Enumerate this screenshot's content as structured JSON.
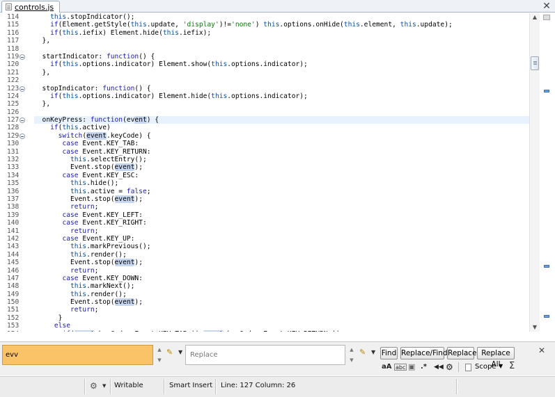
{
  "tab": {
    "title": "controls.js",
    "close": "✕"
  },
  "editor": {
    "current_line": 127,
    "lines": [
      {
        "n": "114",
        "fold": false,
        "html": "    <span class=\"th\">this</span>.stopIndicator();"
      },
      {
        "n": "115",
        "fold": false,
        "html": "    <span class=\"kw\">if</span>(Element.getStyle(<span class=\"th\">this</span>.update, <span class=\"st\">'display'</span>)!=<span class=\"st\">'none'</span>) <span class=\"th\">this</span>.options.onHide(<span class=\"th\">this</span>.element, <span class=\"th\">this</span>.update);"
      },
      {
        "n": "116",
        "fold": false,
        "html": "    <span class=\"kw\">if</span>(<span class=\"th\">this</span>.iefix) Element.hide(<span class=\"th\">this</span>.iefix);"
      },
      {
        "n": "117",
        "fold": false,
        "html": "  },"
      },
      {
        "n": "118",
        "fold": false,
        "html": ""
      },
      {
        "n": "119",
        "fold": true,
        "html": "  startIndicator: <span class=\"kw\">function</span>() {"
      },
      {
        "n": "120",
        "fold": false,
        "html": "    <span class=\"kw\">if</span>(<span class=\"th\">this</span>.options.indicator) Element.show(<span class=\"th\">this</span>.options.indicator);"
      },
      {
        "n": "121",
        "fold": false,
        "html": "  },"
      },
      {
        "n": "122",
        "fold": false,
        "html": ""
      },
      {
        "n": "123",
        "fold": true,
        "html": "  stopIndicator: <span class=\"kw\">function</span>() {"
      },
      {
        "n": "124",
        "fold": false,
        "html": "    <span class=\"kw\">if</span>(<span class=\"th\">this</span>.options.indicator) Element.hide(<span class=\"th\">this</span>.options.indicator);"
      },
      {
        "n": "125",
        "fold": false,
        "html": "  },"
      },
      {
        "n": "126",
        "fold": false,
        "html": ""
      },
      {
        "n": "127",
        "fold": true,
        "html": "  onKeyPress: <span class=\"kw\">function</span>(ev<span class=\"hl\">ent</span>) {"
      },
      {
        "n": "128",
        "fold": false,
        "html": "    <span class=\"kw\">if</span>(<span class=\"th\">this</span>.active)"
      },
      {
        "n": "129",
        "fold": true,
        "html": "      <span class=\"kw\">switch</span>(<span class=\"hl\">event</span>.keyCode) {"
      },
      {
        "n": "130",
        "fold": false,
        "html": "       <span class=\"kw\">case</span> Event.KEY_TAB:"
      },
      {
        "n": "131",
        "fold": false,
        "html": "       <span class=\"kw\">case</span> Event.KEY_RETURN:"
      },
      {
        "n": "132",
        "fold": false,
        "html": "         <span class=\"th\">this</span>.selectEntry();"
      },
      {
        "n": "133",
        "fold": false,
        "html": "         Event.stop(<span class=\"hl\">event</span>);"
      },
      {
        "n": "134",
        "fold": false,
        "html": "       <span class=\"kw\">case</span> Event.KEY_ESC:"
      },
      {
        "n": "135",
        "fold": false,
        "html": "         <span class=\"th\">this</span>.hide();"
      },
      {
        "n": "136",
        "fold": false,
        "html": "         <span class=\"th\">this</span>.active = <span class=\"kw\">false</span>;"
      },
      {
        "n": "137",
        "fold": false,
        "html": "         Event.stop(<span class=\"hl\">event</span>);"
      },
      {
        "n": "138",
        "fold": false,
        "html": "         <span class=\"kw\">return</span>;"
      },
      {
        "n": "139",
        "fold": false,
        "html": "       <span class=\"kw\">case</span> Event.KEY_LEFT:"
      },
      {
        "n": "140",
        "fold": false,
        "html": "       <span class=\"kw\">case</span> Event.KEY_RIGHT:"
      },
      {
        "n": "141",
        "fold": false,
        "html": "         <span class=\"kw\">return</span>;"
      },
      {
        "n": "142",
        "fold": false,
        "html": "       <span class=\"kw\">case</span> Event.KEY_UP:"
      },
      {
        "n": "143",
        "fold": false,
        "html": "         <span class=\"th\">this</span>.markPrevious();"
      },
      {
        "n": "144",
        "fold": false,
        "html": "         <span class=\"th\">this</span>.render();"
      },
      {
        "n": "145",
        "fold": false,
        "html": "         Event.stop(<span class=\"hl\">event</span>);"
      },
      {
        "n": "146",
        "fold": false,
        "html": "         <span class=\"kw\">return</span>;"
      },
      {
        "n": "147",
        "fold": false,
        "html": "       <span class=\"kw\">case</span> Event.KEY_DOWN:"
      },
      {
        "n": "148",
        "fold": false,
        "html": "         <span class=\"th\">this</span>.markNext();"
      },
      {
        "n": "149",
        "fold": false,
        "html": "         <span class=\"th\">this</span>.render();"
      },
      {
        "n": "150",
        "fold": false,
        "html": "         Event.stop(<span class=\"hl\">event</span>);"
      },
      {
        "n": "151",
        "fold": false,
        "html": "         <span class=\"kw\">return</span>;"
      },
      {
        "n": "152",
        "fold": false,
        "html": "      }"
      },
      {
        "n": "153",
        "fold": false,
        "html": "     <span class=\"kw\">else</span>"
      },
      {
        "n": "154",
        "fold": false,
        "html": "       <span class=\"kw\">if</span>(<span class=\"hl\">event</span>.keyCode==Event.KEY_TAB || <span class=\"hl\">event</span>.keyCode==Event.KEY_RETURN ||"
      }
    ]
  },
  "find_bar": {
    "find_value": "evv",
    "replace_placeholder": "Replace",
    "buttons": {
      "find": "Find",
      "replace_find": "Replace/Find",
      "replace": "Replace",
      "replace_all": "Replace All"
    },
    "options": {
      "case_sensitive": "aA",
      "whole_word": "abc",
      "regex": ".*",
      "settings": "⚙",
      "scope": "Scope",
      "sum": "Σ"
    }
  },
  "status": {
    "writable": "Writable",
    "insert_mode": "Smart Insert",
    "position": "Line: 127 Column: 26"
  }
}
